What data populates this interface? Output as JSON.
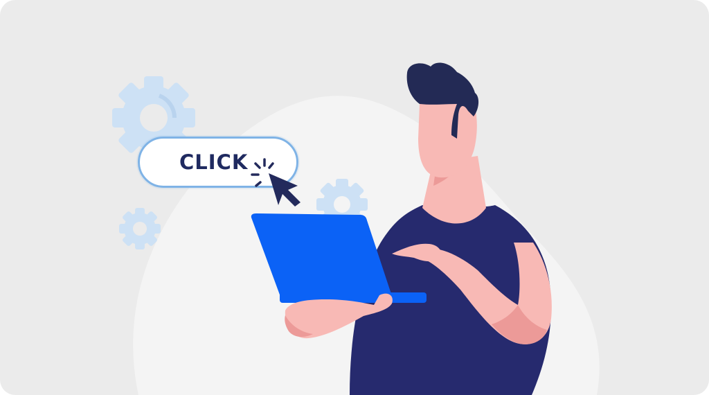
{
  "cta": {
    "label": "CLICK"
  },
  "colors": {
    "background": "#ebebeb",
    "blob": "#f4f4f4",
    "gear": "#cde1f5",
    "button_border": "#7fb3e6",
    "button_text": "#1f2a60",
    "cursor": "#232a5c",
    "laptop": "#0b62f6",
    "shirt": "#262a6e",
    "skin": "#f8b9b5",
    "skin_shadow": "#ec9a98",
    "hair": "#232a55"
  },
  "icons": [
    "gear-icon-large",
    "gear-icon-small",
    "gear-icon-right",
    "cursor-icon",
    "click-burst-icon",
    "laptop-icon"
  ]
}
